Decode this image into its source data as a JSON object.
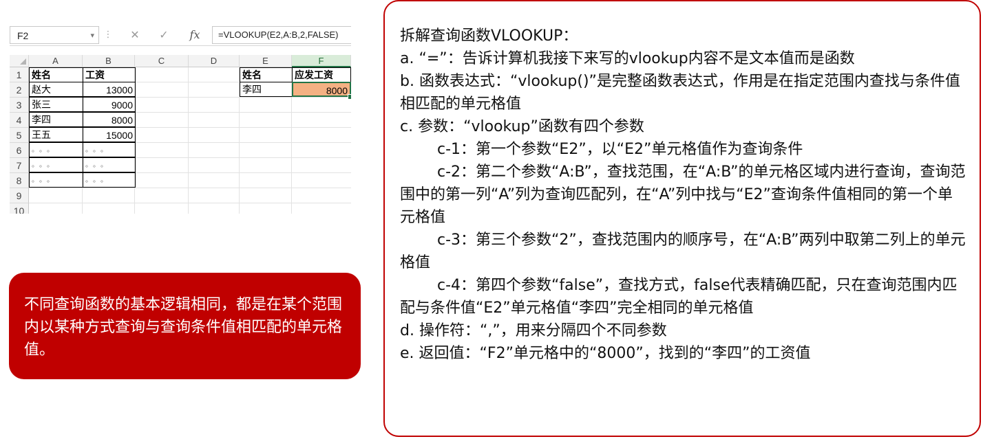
{
  "formula_bar": {
    "name_box": "F2",
    "name_box_dropdown": "▾",
    "divider": "⋮",
    "cancel": "✕",
    "confirm": "✓",
    "fx": "fx",
    "formula": "=VLOOKUP(E2,A:B,2,FALSE)"
  },
  "sheet": {
    "columns": [
      "A",
      "B",
      "C",
      "D",
      "E",
      "F"
    ],
    "selected_column": "F",
    "rows": [
      "1",
      "2",
      "3",
      "4",
      "5",
      "6",
      "7",
      "8",
      "9",
      "10"
    ],
    "table_header": {
      "name": "姓名",
      "salary": "工资"
    },
    "table_rows": [
      {
        "name": "赵大",
        "salary": "13000"
      },
      {
        "name": "张三",
        "salary": "9000"
      },
      {
        "name": "李四",
        "salary": "8000"
      },
      {
        "name": "王五",
        "salary": "15000"
      },
      {
        "name": "。。。",
        "salary": "。。。"
      },
      {
        "name": "。。。",
        "salary": "。。。"
      },
      {
        "name": "。。。",
        "salary": "。。。"
      }
    ],
    "lookup_header": {
      "name": "姓名",
      "pay": "应发工资"
    },
    "lookup_row": {
      "name": "李四",
      "pay": "8000"
    }
  },
  "callout": {
    "text": "不同查询函数的基本逻辑相同，都是在某个范围内以某种方式查询与查询条件值相匹配的单元格值。"
  },
  "explanation": {
    "title": "拆解查询函数VLOOKUP：",
    "a": "a. “=”：告诉计算机我接下来写的vlookup内容不是文本值而是函数",
    "b": "b. 函数表达式：“vlookup()”是完整函数表达式，作用是在指定范围内查找与条件值相匹配的单元格值",
    "c": "c. 参数：“vlookup”函数有四个参数",
    "c1": "c-1：第一个参数“E2”，以“E2”单元格值作为查询条件",
    "c2": "c-2：第二个参数“A:B”，查找范围，在“A:B”的单元格区域内进行查询，查询范围中的第一列“A”列为查询匹配列，在“A”列中找与“E2”查询条件值相同的第一个单元格值",
    "c3": "c-3：第三个参数“2”，查找范围内的顺序号，在“A:B”两列中取第二列上的单元格值",
    "c4": "c-4：第四个参数“false”，查找方式，false代表精确匹配，只在查询范围内匹配与条件值“E2”单元格值“李四”完全相同的单元格值",
    "d": "d. 操作符：“,”，用来分隔四个不同参数",
    "e": "e. 返回值：“F2”单元格中的“8000”，找到的“李四”的工资值"
  },
  "colors": {
    "accent_red": "#c00000",
    "result_fill": "#f4b183",
    "selection_green": "#217346"
  }
}
